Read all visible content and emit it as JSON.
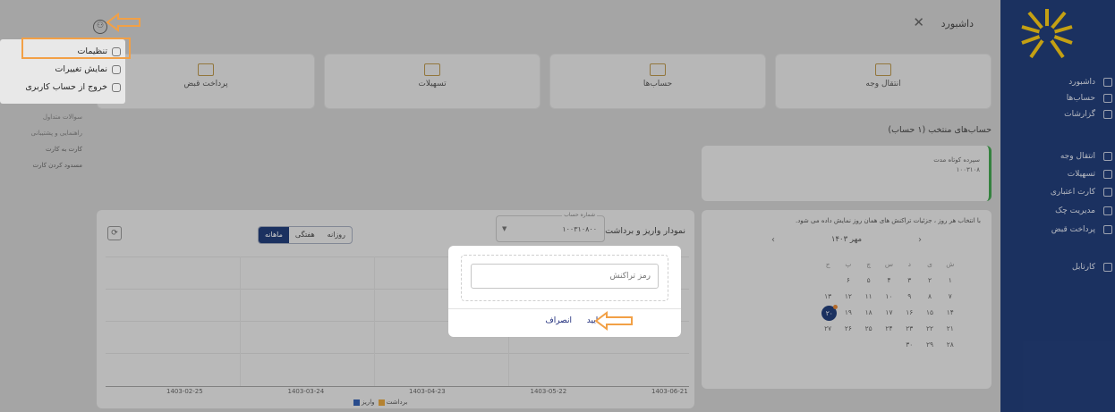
{
  "header": {
    "title": "داشبورد"
  },
  "sidebar": {
    "items": [
      {
        "label": "داشبورد",
        "icon": "dashboard-icon"
      },
      {
        "label": "حساب‌ها",
        "icon": "bank-icon"
      },
      {
        "label": "گزارشات",
        "icon": "clock-icon"
      },
      {
        "label": "انتقال وجه",
        "icon": "card-icon"
      },
      {
        "label": "تسهیلات",
        "icon": "loan-icon"
      },
      {
        "label": "کارت اعتباری",
        "icon": "credit-card-icon"
      },
      {
        "label": "مدیریت چک",
        "icon": "cheque-icon"
      },
      {
        "label": "پرداخت قبض",
        "icon": "bill-icon"
      },
      {
        "label": "کارتابل",
        "icon": "inbox-icon"
      }
    ]
  },
  "cards": [
    {
      "label": "انتقال وجه"
    },
    {
      "label": "حساب‌ها"
    },
    {
      "label": "تسهیلات"
    },
    {
      "label": "پرداخت قبض"
    }
  ],
  "accounts": {
    "section_title": "حساب‌های منتخب (۱ حساب)",
    "card": {
      "type": "سپرده کوتاه مدت",
      "number": "۱۰۰۳۱۰۸"
    }
  },
  "calendar": {
    "hint": "با انتخاب هر روز ، جزئیات تراکنش های همان روز نمایش داده می شود.",
    "month": "مهر ۱۴۰۳",
    "weekdays": [
      "ش",
      "ی",
      "د",
      "س",
      "چ",
      "پ",
      "ج"
    ],
    "weeks": [
      [
        "",
        "",
        "۱",
        "۲",
        "۳",
        "۴",
        "۵",
        "۶"
      ],
      [
        "۷",
        "۸",
        "۹",
        "۱۰",
        "۱۱",
        "۱۲",
        "۱۳"
      ],
      [
        "۱۴",
        "۱۵",
        "۱۶",
        "۱۷",
        "۱۸",
        "۱۹",
        "۲۰"
      ],
      [
        "۲۱",
        "۲۲",
        "۲۳",
        "۲۴",
        "۲۵",
        "۲۶",
        "۲۷"
      ],
      [
        "۲۸",
        "۲۹",
        "۳۰"
      ]
    ],
    "today": "۲۰"
  },
  "chart": {
    "title": "نمودار واریز و برداشت",
    "account_label": "شماره حساب",
    "account_value": "۱۰۰۳۱۰۸۰۰",
    "tabs": [
      "روزانه",
      "هفتگی",
      "ماهانه"
    ],
    "active_tab": "ماهانه",
    "legend": {
      "withdraw": "برداشت",
      "deposit": "واریز"
    }
  },
  "chart_data": {
    "type": "bar",
    "categories": [
      "1403-02-25",
      "1403-03-24",
      "1403-04-23",
      "1403-05-22",
      "1403-06-21"
    ],
    "series": [
      {
        "name": "برداشت",
        "values": [
          0,
          0,
          0,
          0,
          0
        ],
        "color": "#e09a2b"
      },
      {
        "name": "واریز",
        "values": [
          0,
          0,
          0,
          0,
          0
        ],
        "color": "#1f4fa8"
      }
    ],
    "ylim": [
      0,
      1
    ]
  },
  "left_panel": {
    "items": [
      "سوالات متداول",
      "راهنمایی و پشتیبانی",
      "کارت به کارت",
      "مسدود کردن کارت"
    ]
  },
  "menu": {
    "items": [
      {
        "label": "تنظیمات",
        "icon": "gear-icon"
      },
      {
        "label": "نمایش تغییرات",
        "icon": "changes-icon"
      },
      {
        "label": "خروج از حساب کاربری",
        "icon": "logout-icon"
      }
    ]
  },
  "modal": {
    "placeholder": "رمز تراکنش",
    "confirm": "تایید",
    "cancel": "انصراف"
  },
  "colors": {
    "sidebar": "#0c2a6b",
    "accent_orange": "#f2a046",
    "active_green": "#2e9a3c"
  }
}
